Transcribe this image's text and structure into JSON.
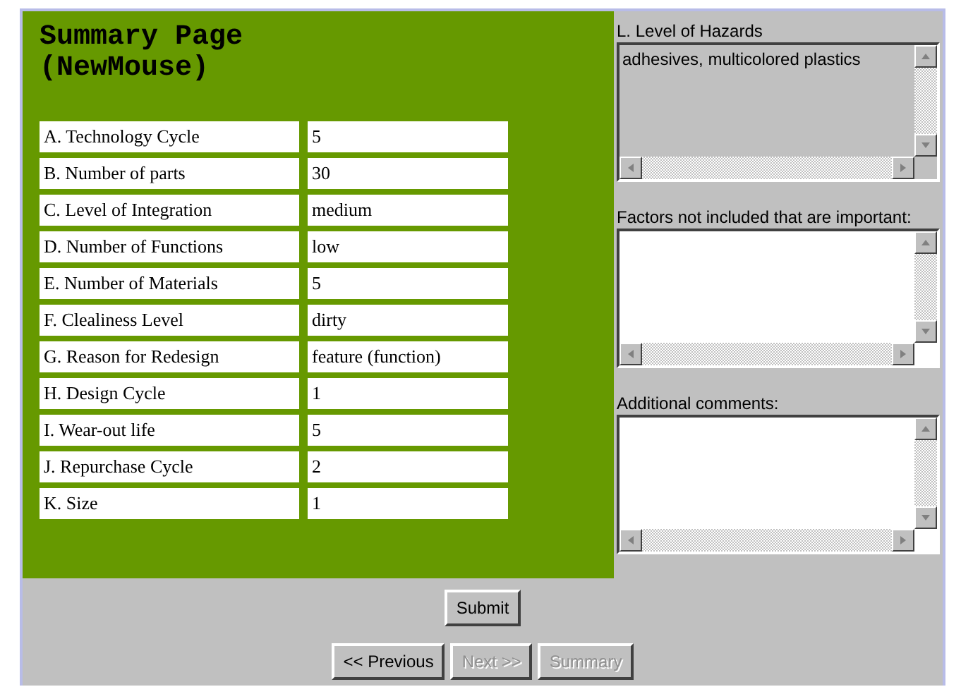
{
  "title": "Summary Page (NewMouse)",
  "rows": [
    {
      "label": "A. Technology Cycle",
      "value": "5"
    },
    {
      "label": "B. Number of parts",
      "value": "30"
    },
    {
      "label": "C. Level of Integration",
      "value": "medium"
    },
    {
      "label": "D. Number of Functions",
      "value": "low"
    },
    {
      "label": "E. Number of Materials",
      "value": "5"
    },
    {
      "label": "F. Clealiness Level",
      "value": "dirty"
    },
    {
      "label": "G. Reason for Redesign",
      "value": "feature (function)"
    },
    {
      "label": "H. Design Cycle",
      "value": "1"
    },
    {
      "label": "I. Wear-out life",
      "value": "5"
    },
    {
      "label": "J. Repurchase Cycle",
      "value": "2"
    },
    {
      "label": "K. Size",
      "value": "1"
    }
  ],
  "text_areas": [
    {
      "label": "L. Level of Hazards",
      "value": "adhesives, multicolored plastics",
      "disabled": true
    },
    {
      "label": "Factors not included that are important:",
      "disabled": false
    },
    {
      "label": "Additional comments:",
      "disabled": false
    }
  ],
  "submit": "Submit",
  "nav_buttons": [
    {
      "label": "<< Previous",
      "disabled": false
    },
    {
      "label": "Next >>",
      "disabled": true
    },
    {
      "label": "Summary",
      "disabled": true
    }
  ]
}
